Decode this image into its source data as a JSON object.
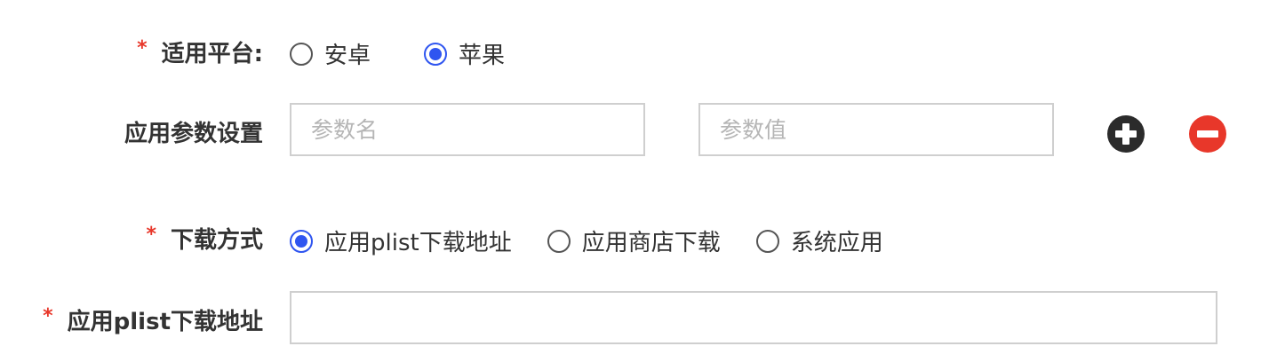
{
  "platform": {
    "label": "适用平台:",
    "required_mark": "*",
    "options": [
      {
        "label": "安卓",
        "checked": false
      },
      {
        "label": "苹果",
        "checked": true
      }
    ]
  },
  "params": {
    "label": "应用参数设置",
    "name_placeholder": "参数名",
    "value_placeholder": "参数值",
    "add_icon": "plus-circle-icon",
    "remove_icon": "minus-circle-icon"
  },
  "download": {
    "label": "下载方式",
    "required_mark": "*",
    "options": [
      {
        "label": "应用plist下载地址",
        "checked": true
      },
      {
        "label": "应用商店下载",
        "checked": false
      },
      {
        "label": "系统应用",
        "checked": false
      }
    ]
  },
  "plist": {
    "label": "应用plist下载地址",
    "required_mark": "*",
    "value": ""
  },
  "colors": {
    "accent": "#2f55f0",
    "required": "#e8372a",
    "add_icon": "#2b2b2b",
    "remove_icon": "#e8372a"
  }
}
